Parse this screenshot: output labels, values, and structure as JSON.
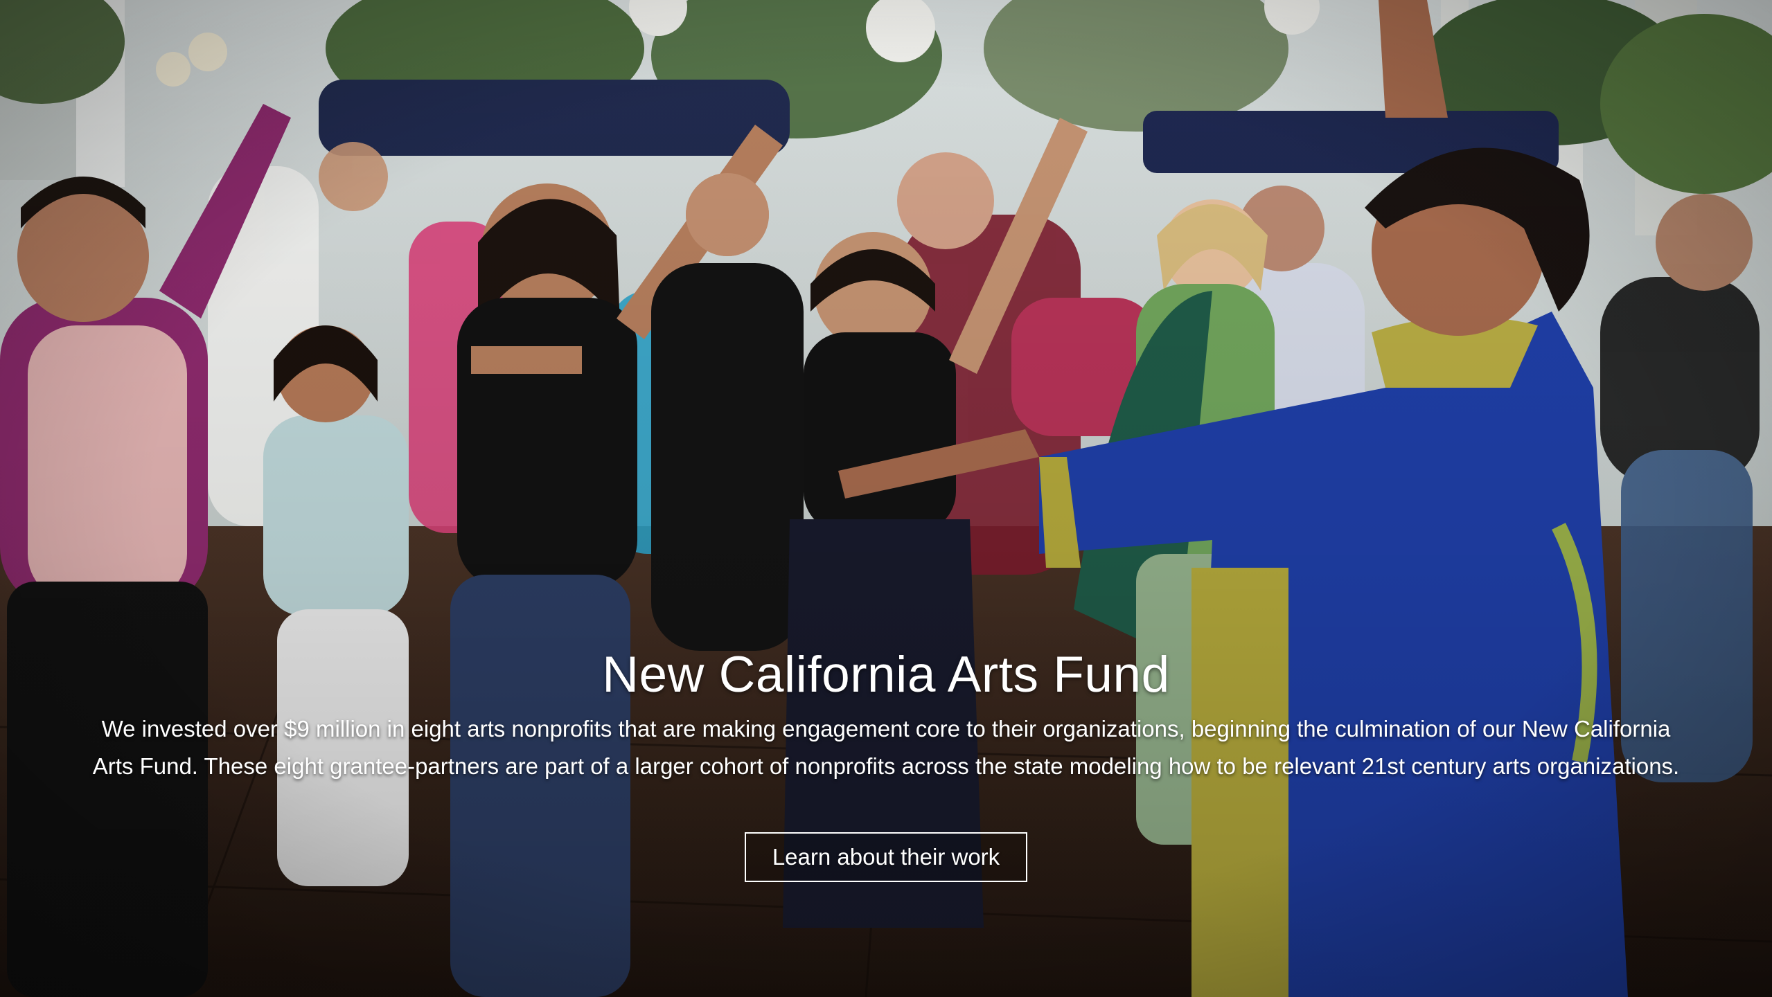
{
  "hero": {
    "title": "New California Arts Fund",
    "description": "We invested over $9 million in eight arts nonprofits that are making engagement core to their organizations, beginning the culmination of our New California Arts Fund. These eight grantee-partners are part of a larger cohort of nonprofits across the state modeling how to be relevant 21st century arts organizations.",
    "cta_label": "Learn about their work"
  }
}
